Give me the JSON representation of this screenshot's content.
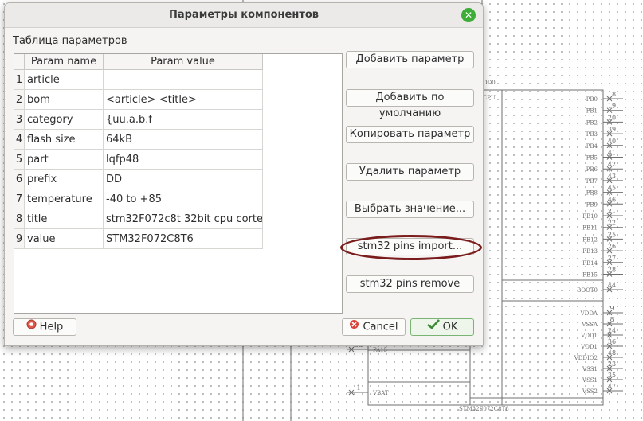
{
  "dialog": {
    "title": "Параметры компонентов",
    "close_icon": "close-icon",
    "section_label": "Таблица параметров"
  },
  "table": {
    "headers": [
      "Param name",
      "Param value"
    ],
    "rows": [
      {
        "index": "1",
        "name": "article",
        "value": ""
      },
      {
        "index": "2",
        "name": "bom",
        "value": "<article> <title>"
      },
      {
        "index": "3",
        "name": "category",
        "value": "{uu.a.b.f"
      },
      {
        "index": "4",
        "name": "flash size",
        "value": "64kB"
      },
      {
        "index": "5",
        "name": "part",
        "value": "lqfp48"
      },
      {
        "index": "6",
        "name": "prefix",
        "value": "DD"
      },
      {
        "index": "7",
        "name": "temperature",
        "value": "-40 to +85"
      },
      {
        "index": "8",
        "name": "title",
        "value": "stm32F072c8t 32bit cpu corte…"
      },
      {
        "index": "9",
        "name": "value",
        "value": "STM32F072C8T6"
      }
    ]
  },
  "buttons": {
    "add_param": "Добавить параметр",
    "add_default": "Добавить по умолчанию",
    "copy_param": "Копировать параметр",
    "delete_param": "Удалить параметр",
    "choose_value": "Выбрать значение...",
    "pins_import": "stm32 pins import...",
    "pins_remove": "stm32 pins remove",
    "help": "Help",
    "cancel": "Cancel",
    "ok": "OK"
  },
  "schematic": {
    "top_label": "DD0",
    "cpu_label": "CPU",
    "part_label": "STM32F072C8T6",
    "right_pins": [
      {
        "name": "PB0",
        "num": "18"
      },
      {
        "name": "PB1",
        "num": "19"
      },
      {
        "name": "PB2",
        "num": "20"
      },
      {
        "name": "PB3",
        "num": "39"
      },
      {
        "name": "PB4",
        "num": "40"
      },
      {
        "name": "PB5",
        "num": "41"
      },
      {
        "name": "PB6",
        "num": "42"
      },
      {
        "name": "PB7",
        "num": "43"
      },
      {
        "name": "PB8",
        "num": "45"
      },
      {
        "name": "PB9",
        "num": "46"
      },
      {
        "name": "PB10",
        "num": "21"
      },
      {
        "name": "PB11",
        "num": "22"
      },
      {
        "name": "PB12",
        "num": "25"
      },
      {
        "name": "PB13",
        "num": "26"
      },
      {
        "name": "PB14",
        "num": "27"
      },
      {
        "name": "PB15",
        "num": "28"
      }
    ],
    "boot_pin": {
      "name": "BOOT0",
      "num": "44"
    },
    "power_pins": [
      {
        "name": "VDDA",
        "num": "9"
      },
      {
        "name": "VSSA",
        "num": "8"
      },
      {
        "name": "VDD1",
        "num": "24"
      },
      {
        "name": "VDD1",
        "num": "36"
      },
      {
        "name": "VDDIO2",
        "num": "48"
      },
      {
        "name": "VSS1",
        "num": "23"
      },
      {
        "name": "VSS1",
        "num": "35"
      },
      {
        "name": "VSS2",
        "num": "47"
      }
    ],
    "left_pins": [
      {
        "name": "PA15",
        "num": "38"
      },
      {
        "name": "VBAT",
        "num": "1"
      }
    ]
  }
}
